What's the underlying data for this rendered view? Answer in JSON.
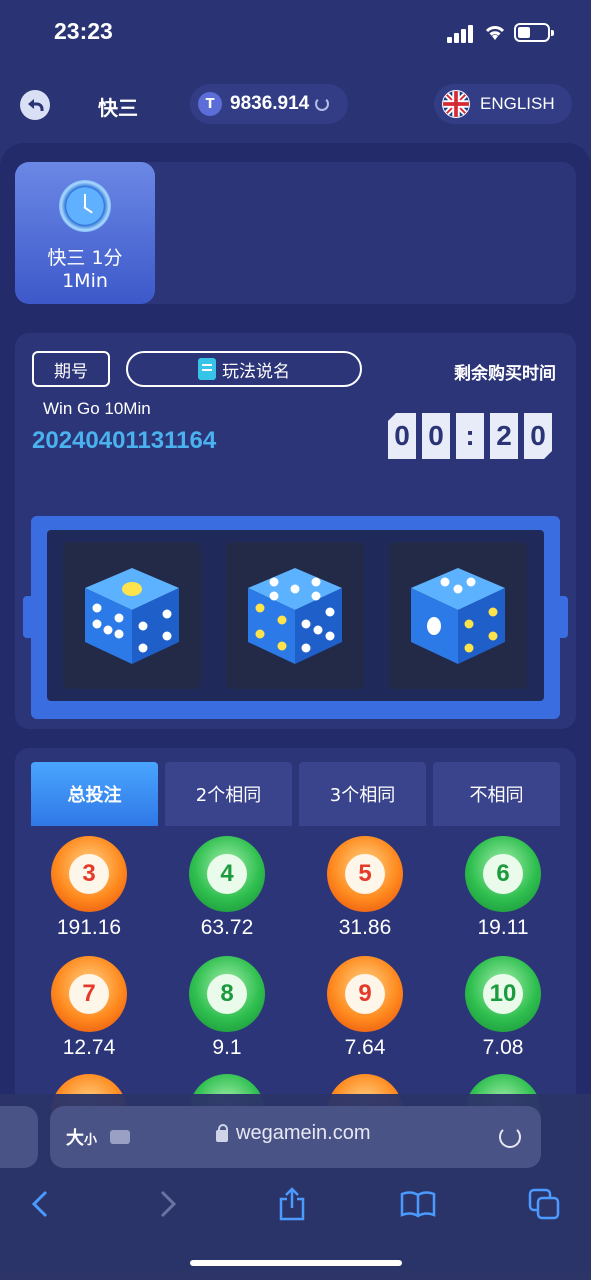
{
  "status": {
    "time": "23:23"
  },
  "header": {
    "title": "快三",
    "balance": "9836.914",
    "language": "ENGLISH"
  },
  "modes": [
    {
      "name": "快三 1分",
      "duration": "1Min"
    }
  ],
  "round": {
    "period_label": "期号",
    "rules_label": "玩法说名",
    "remaining_label": "剩余购买时间",
    "game_name": "Win Go 10Min",
    "period_number": "20240401131164",
    "timer_digits": [
      "0",
      "0",
      ":",
      "2",
      "0"
    ]
  },
  "dice": [
    1,
    5,
    4
  ],
  "bet": {
    "tabs": [
      "总投注",
      "2个相同",
      "3个相同",
      "不相同"
    ],
    "active_tab": 0,
    "balls": [
      {
        "number": "3",
        "odds": "191.16",
        "color": "red"
      },
      {
        "number": "4",
        "odds": "63.72",
        "color": "green"
      },
      {
        "number": "5",
        "odds": "31.86",
        "color": "red"
      },
      {
        "number": "6",
        "odds": "19.11",
        "color": "green"
      },
      {
        "number": "7",
        "odds": "12.74",
        "color": "red"
      },
      {
        "number": "8",
        "odds": "9.1",
        "color": "green"
      },
      {
        "number": "9",
        "odds": "7.64",
        "color": "red"
      },
      {
        "number": "10",
        "odds": "7.08",
        "color": "green"
      }
    ]
  },
  "browser": {
    "text_size_label": "大",
    "text_size_small": "小",
    "url": "wegamein.com"
  }
}
